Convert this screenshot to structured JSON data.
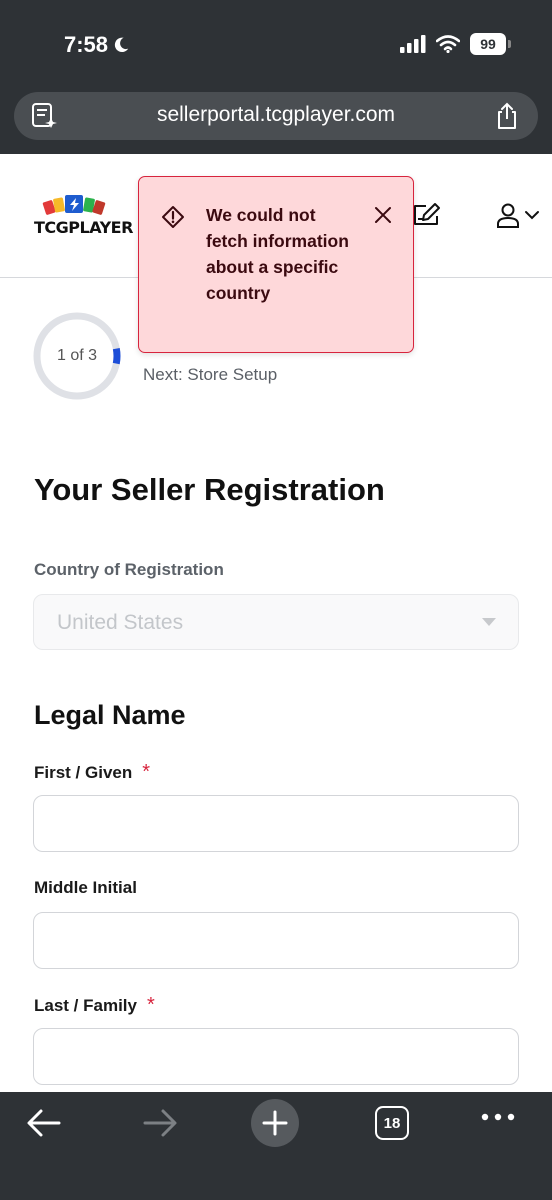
{
  "status_bar": {
    "time": "7:58",
    "battery": "99"
  },
  "browser": {
    "url": "sellerportal.tcgplayer.com",
    "tab_count": "18"
  },
  "header": {
    "logo_text": "TCGPLAYER"
  },
  "toast": {
    "message": "We could not fetch information about a specific country",
    "type": "error"
  },
  "progress": {
    "label": "1 of 3",
    "current": 1,
    "total": 3,
    "next_step": "Next: Store Setup"
  },
  "form": {
    "title": "Your Seller Registration",
    "country": {
      "label": "Country of Registration",
      "value": "United States"
    },
    "legal_name": {
      "title": "Legal Name",
      "first": {
        "label": "First / Given",
        "required_mark": "*",
        "value": ""
      },
      "middle": {
        "label": "Middle Initial",
        "value": ""
      },
      "last": {
        "label": "Last / Family",
        "required_mark": "*",
        "value": ""
      }
    }
  },
  "colors": {
    "error_bg": "#fed8da",
    "error_border": "#d7243d",
    "required": "#d7243d",
    "progress_fill": "#1d4ed8",
    "chrome": "#2e3236"
  }
}
